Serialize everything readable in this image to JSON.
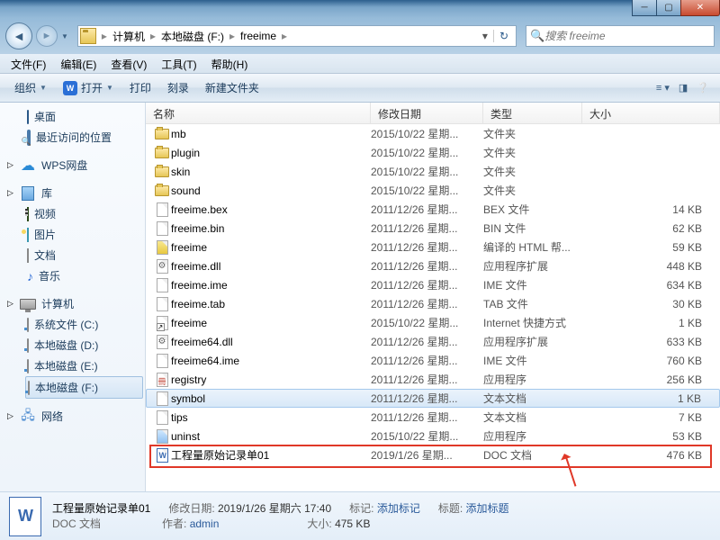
{
  "breadcrumb": [
    "计算机",
    "本地磁盘 (F:)",
    "freeime"
  ],
  "search_placeholder": "搜索 freeime",
  "menu": {
    "file": "文件(F)",
    "edit": "编辑(E)",
    "view": "查看(V)",
    "tools": "工具(T)",
    "help": "帮助(H)"
  },
  "toolbar": {
    "organize": "组织",
    "open": "打开",
    "print": "打印",
    "burn": "刻录",
    "newfolder": "新建文件夹"
  },
  "sidebar": {
    "desktop": "桌面",
    "recent": "最近访问的位置",
    "wps": "WPS网盘",
    "libraries": "库",
    "videos": "视频",
    "pictures": "图片",
    "documents": "文档",
    "music": "音乐",
    "computer": "计算机",
    "drive_c": "系统文件 (C:)",
    "drive_d": "本地磁盘 (D:)",
    "drive_e": "本地磁盘 (E:)",
    "drive_f": "本地磁盘 (F:)",
    "network": "网络"
  },
  "columns": {
    "name": "名称",
    "date": "修改日期",
    "type": "类型",
    "size": "大小"
  },
  "files": [
    {
      "ic": "folder",
      "n": "mb",
      "d": "2015/10/22 星期...",
      "t": "文件夹",
      "s": ""
    },
    {
      "ic": "folder",
      "n": "plugin",
      "d": "2015/10/22 星期...",
      "t": "文件夹",
      "s": ""
    },
    {
      "ic": "folder",
      "n": "skin",
      "d": "2015/10/22 星期...",
      "t": "文件夹",
      "s": ""
    },
    {
      "ic": "folder",
      "n": "sound",
      "d": "2015/10/22 星期...",
      "t": "文件夹",
      "s": ""
    },
    {
      "ic": "file",
      "n": "freeime.bex",
      "d": "2011/12/26 星期...",
      "t": "BEX 文件",
      "s": "14 KB"
    },
    {
      "ic": "file",
      "n": "freeime.bin",
      "d": "2011/12/26 星期...",
      "t": "BIN 文件",
      "s": "62 KB"
    },
    {
      "ic": "chm",
      "n": "freeime",
      "d": "2011/12/26 星期...",
      "t": "编译的 HTML 帮...",
      "s": "59 KB"
    },
    {
      "ic": "dll",
      "n": "freeime.dll",
      "d": "2011/12/26 星期...",
      "t": "应用程序扩展",
      "s": "448 KB"
    },
    {
      "ic": "file",
      "n": "freeime.ime",
      "d": "2011/12/26 星期...",
      "t": "IME 文件",
      "s": "634 KB"
    },
    {
      "ic": "file",
      "n": "freeime.tab",
      "d": "2011/12/26 星期...",
      "t": "TAB 文件",
      "s": "30 KB"
    },
    {
      "ic": "link",
      "n": "freeime",
      "d": "2015/10/22 星期...",
      "t": "Internet 快捷方式",
      "s": "1 KB"
    },
    {
      "ic": "dll",
      "n": "freeime64.dll",
      "d": "2011/12/26 星期...",
      "t": "应用程序扩展",
      "s": "633 KB"
    },
    {
      "ic": "file",
      "n": "freeime64.ime",
      "d": "2011/12/26 星期...",
      "t": "IME 文件",
      "s": "760 KB"
    },
    {
      "ic": "reg",
      "n": "registry",
      "d": "2011/12/26 星期...",
      "t": "应用程序",
      "s": "256 KB"
    },
    {
      "ic": "file",
      "n": "symbol",
      "d": "2011/12/26 星期...",
      "t": "文本文档",
      "s": "1 KB",
      "sel": true
    },
    {
      "ic": "file",
      "n": "tips",
      "d": "2011/12/26 星期...",
      "t": "文本文档",
      "s": "7 KB"
    },
    {
      "ic": "exe",
      "n": "uninst",
      "d": "2015/10/22 星期...",
      "t": "应用程序",
      "s": "53 KB"
    },
    {
      "ic": "word",
      "n": "工程量原始记录单01",
      "d": "2019/1/26 星期...",
      "t": "DOC 文档",
      "s": "476 KB"
    }
  ],
  "details": {
    "title": "工程量原始记录单01",
    "subtitle": "DOC 文档",
    "mod_label": "修改日期:",
    "mod_val": "2019/1/26 星期六 17:40",
    "tag_label": "标记:",
    "tag_val": "添加标记",
    "title_label": "标题:",
    "title_val": "添加标题",
    "author_label": "作者:",
    "author_val": "admin",
    "size_label": "大小:",
    "size_val": "475 KB"
  }
}
